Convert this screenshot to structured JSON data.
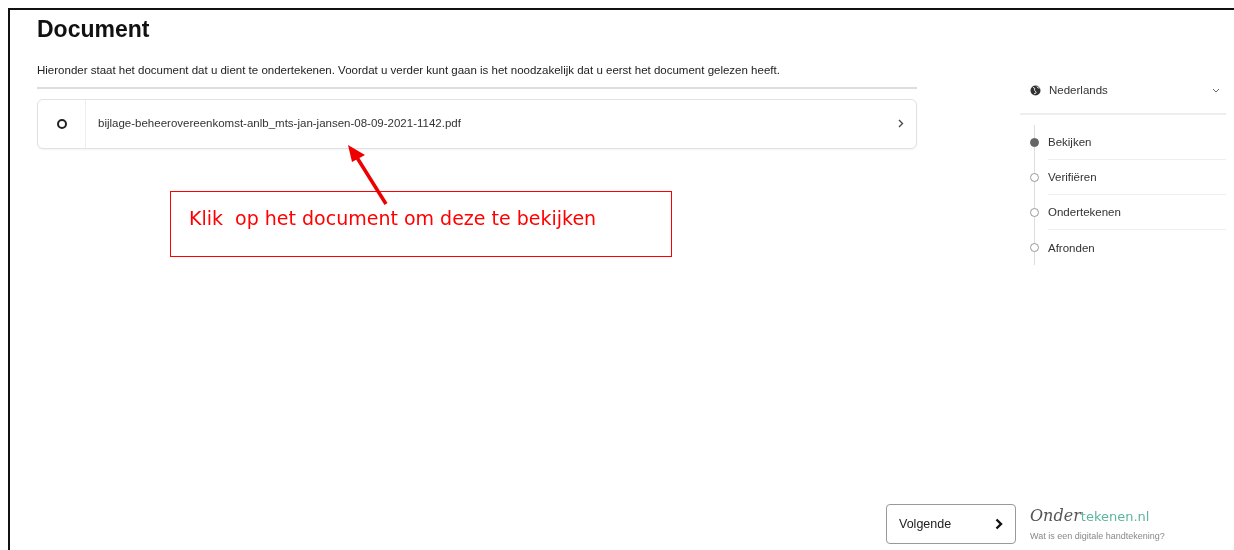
{
  "title": "Document",
  "intro": "Hieronder staat het document dat u dient te ondertekenen. Voordat u verder kunt gaan is het noodzakelijk dat u eerst het document gelezen heeft.",
  "documents": [
    {
      "name": "bijlage-beheerovereenkomst-anlb_mts-jan-jansen-08-09-2021-1142.pdf"
    }
  ],
  "callout": {
    "text": "Klik  op het document om deze te bekijken"
  },
  "language": {
    "label": "Nederlands"
  },
  "steps": [
    {
      "label": "Bekijken",
      "selected": true
    },
    {
      "label": "Verifiëren",
      "selected": false
    },
    {
      "label": "Ondertekenen",
      "selected": false
    },
    {
      "label": "Afronden",
      "selected": false
    }
  ],
  "next_button": {
    "label": "Volgende"
  },
  "logo": {
    "lead": "Onder",
    "rest": "tekenen.nl"
  },
  "help_link": "Wat is een digitale handtekening?"
}
